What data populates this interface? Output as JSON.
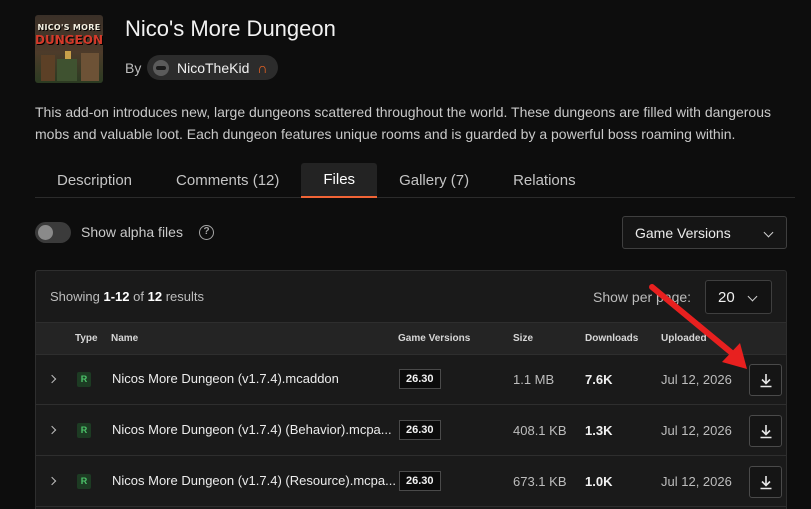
{
  "project": {
    "logo_line1": "NICO'S MORE",
    "logo_line2": "DUNGEON",
    "title": "Nico's More Dungeon",
    "by_label": "By",
    "author": "NicoTheKid",
    "description": "This add-on introduces new, large dungeons scattered throughout the world. These dungeons are filled with dangerous mobs and valuable loot. Each dungeon features unique rooms and is guarded by a powerful boss roaming within."
  },
  "tabs": [
    {
      "label": "Description"
    },
    {
      "label": "Comments (12)"
    },
    {
      "label": "Files",
      "active": true
    },
    {
      "label": "Gallery (7)"
    },
    {
      "label": "Relations"
    }
  ],
  "filters": {
    "alpha_label": "Show alpha files",
    "alpha_enabled": false,
    "help_glyph": "?",
    "game_versions_label": "Game Versions"
  },
  "results": {
    "prefix": "Showing",
    "range": "1-12",
    "of": "of",
    "total": "12",
    "suffix": "results",
    "per_page_label": "Show per page:",
    "per_page_value": "20"
  },
  "table": {
    "headers": {
      "type": "Type",
      "name": "Name",
      "game_versions": "Game Versions",
      "size": "Size",
      "downloads": "Downloads",
      "uploaded": "Uploaded"
    },
    "rows": [
      {
        "type": "R",
        "name": "Nicos More Dungeon (v1.7.4).mcaddon",
        "version": "26.30",
        "size": "1.1 MB",
        "downloads": "7.6K",
        "uploaded": "Jul 12, 2026"
      },
      {
        "type": "R",
        "name": "Nicos More Dungeon (v1.7.4) (Behavior).mcpa...",
        "version": "26.30",
        "size": "408.1 KB",
        "downloads": "1.3K",
        "uploaded": "Jul 12, 2026"
      },
      {
        "type": "R",
        "name": "Nicos More Dungeon (v1.7.4) (Resource).mcpa...",
        "version": "26.30",
        "size": "673.1 KB",
        "downloads": "1.0K",
        "uploaded": "Jul 12, 2026"
      }
    ]
  },
  "colors": {
    "accent": "#f16436",
    "annotation_arrow": "#e8201f",
    "release_badge": "#4cc46a"
  },
  "icons": {
    "download": "download-icon",
    "expand": "chevron-right-icon",
    "dropdown": "chevron-down-icon",
    "help": "help-circle-icon",
    "author_badge": "magnet-icon"
  }
}
